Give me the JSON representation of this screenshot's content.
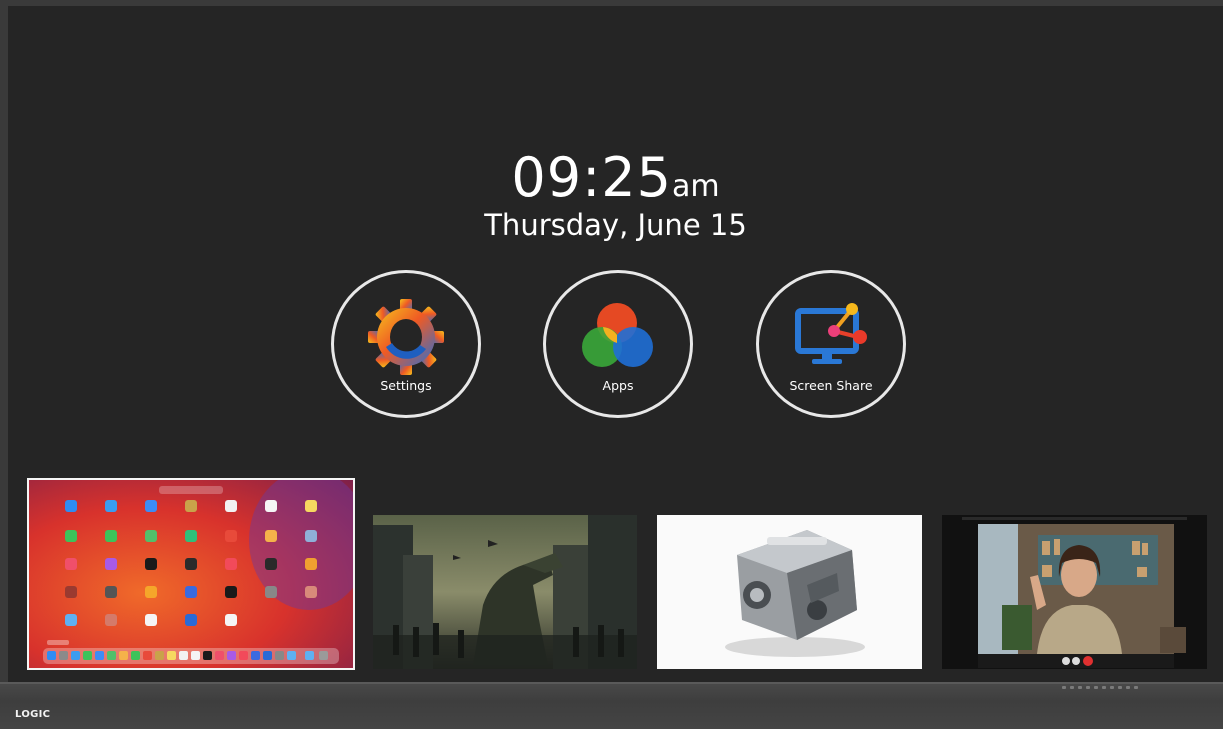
{
  "clock": {
    "time": "09:25",
    "ampm": "am",
    "date": "Thursday, June 15"
  },
  "tiles": [
    {
      "label": "Settings",
      "icon": "gear-icon"
    },
    {
      "label": "Apps",
      "icon": "apps-icon"
    },
    {
      "label": "Screen Share",
      "icon": "screen-share-icon"
    }
  ],
  "thumbnails": [
    {
      "name": "mac-launchpad-desktop",
      "selected": true
    },
    {
      "name": "dinosaur-city-scene",
      "selected": false
    },
    {
      "name": "engine-render",
      "selected": false
    },
    {
      "name": "video-call-woman",
      "selected": false
    }
  ],
  "brand": "LOGIC",
  "colors": {
    "screen_bg": "#252525",
    "bezel": "#3a3a3a",
    "tile_ring": "#e8e8e8"
  }
}
